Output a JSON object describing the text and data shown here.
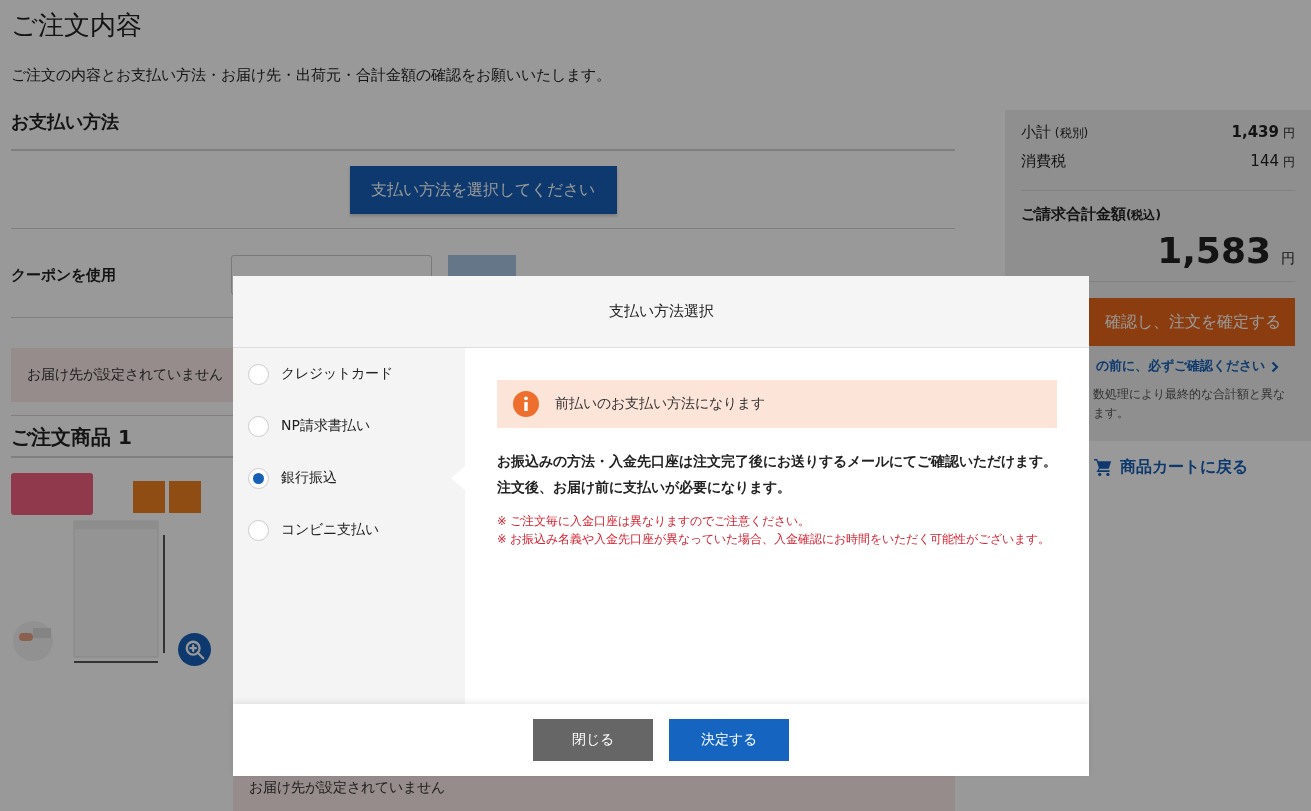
{
  "page": {
    "title": "ご注文内容",
    "description": "ご注文の内容とお支払い方法・お届け先・出荷元・合計金額の確認をお願いいたします。"
  },
  "payment_section": {
    "heading": "お支払い方法",
    "select_button": "支払い方法を選択してください"
  },
  "coupon": {
    "label": "クーポンを使用"
  },
  "shipping_notice": "お届け先が設定されていません",
  "order_items": {
    "heading": "ご注文商品 1"
  },
  "bottom_notice": "お届け先が設定されていません",
  "summary": {
    "rows": [
      {
        "label": "小計",
        "note": "(税別)",
        "amount": "1,439",
        "unit": "円",
        "bold": true
      },
      {
        "label": "消費税",
        "amount": "144",
        "unit": "円",
        "bold": false
      }
    ],
    "total_label": "ご請求合計金額",
    "total_note": "(税込)",
    "total_amount": "1,583",
    "total_unit": "円",
    "confirm_button": "確認し、注文を確定する",
    "notice_link": "の前に、必ずご確認ください",
    "note_lines": [
      "数処理により最終的な合計額と異な",
      "ます。"
    ]
  },
  "cart_link": "商品カートに戻る",
  "modal": {
    "title": "支払い方法選択",
    "options": [
      {
        "label": "クレジットカード",
        "selected": false
      },
      {
        "label": "NP請求書払い",
        "selected": false
      },
      {
        "label": "銀行振込",
        "selected": true
      },
      {
        "label": "コンビニ支払い",
        "selected": false
      }
    ],
    "alert": "前払いのお支払い方法になります",
    "body_lines": [
      "お振込みの方法・入金先口座は注文完了後にお送りするメールにてご確認いただけます。",
      "注文後、お届け前に支払いが必要になります。"
    ],
    "notes": [
      "※ ご注文毎に入金口座は異なりますのでご注意ください。",
      "※ お振込み名義や入金先口座が異なっていた場合、入金確認にお時間をいただく可能性がございます。"
    ],
    "buttons": [
      {
        "label": "閉じる",
        "kind": "secondary"
      },
      {
        "label": "決定する",
        "kind": "primary"
      }
    ]
  }
}
